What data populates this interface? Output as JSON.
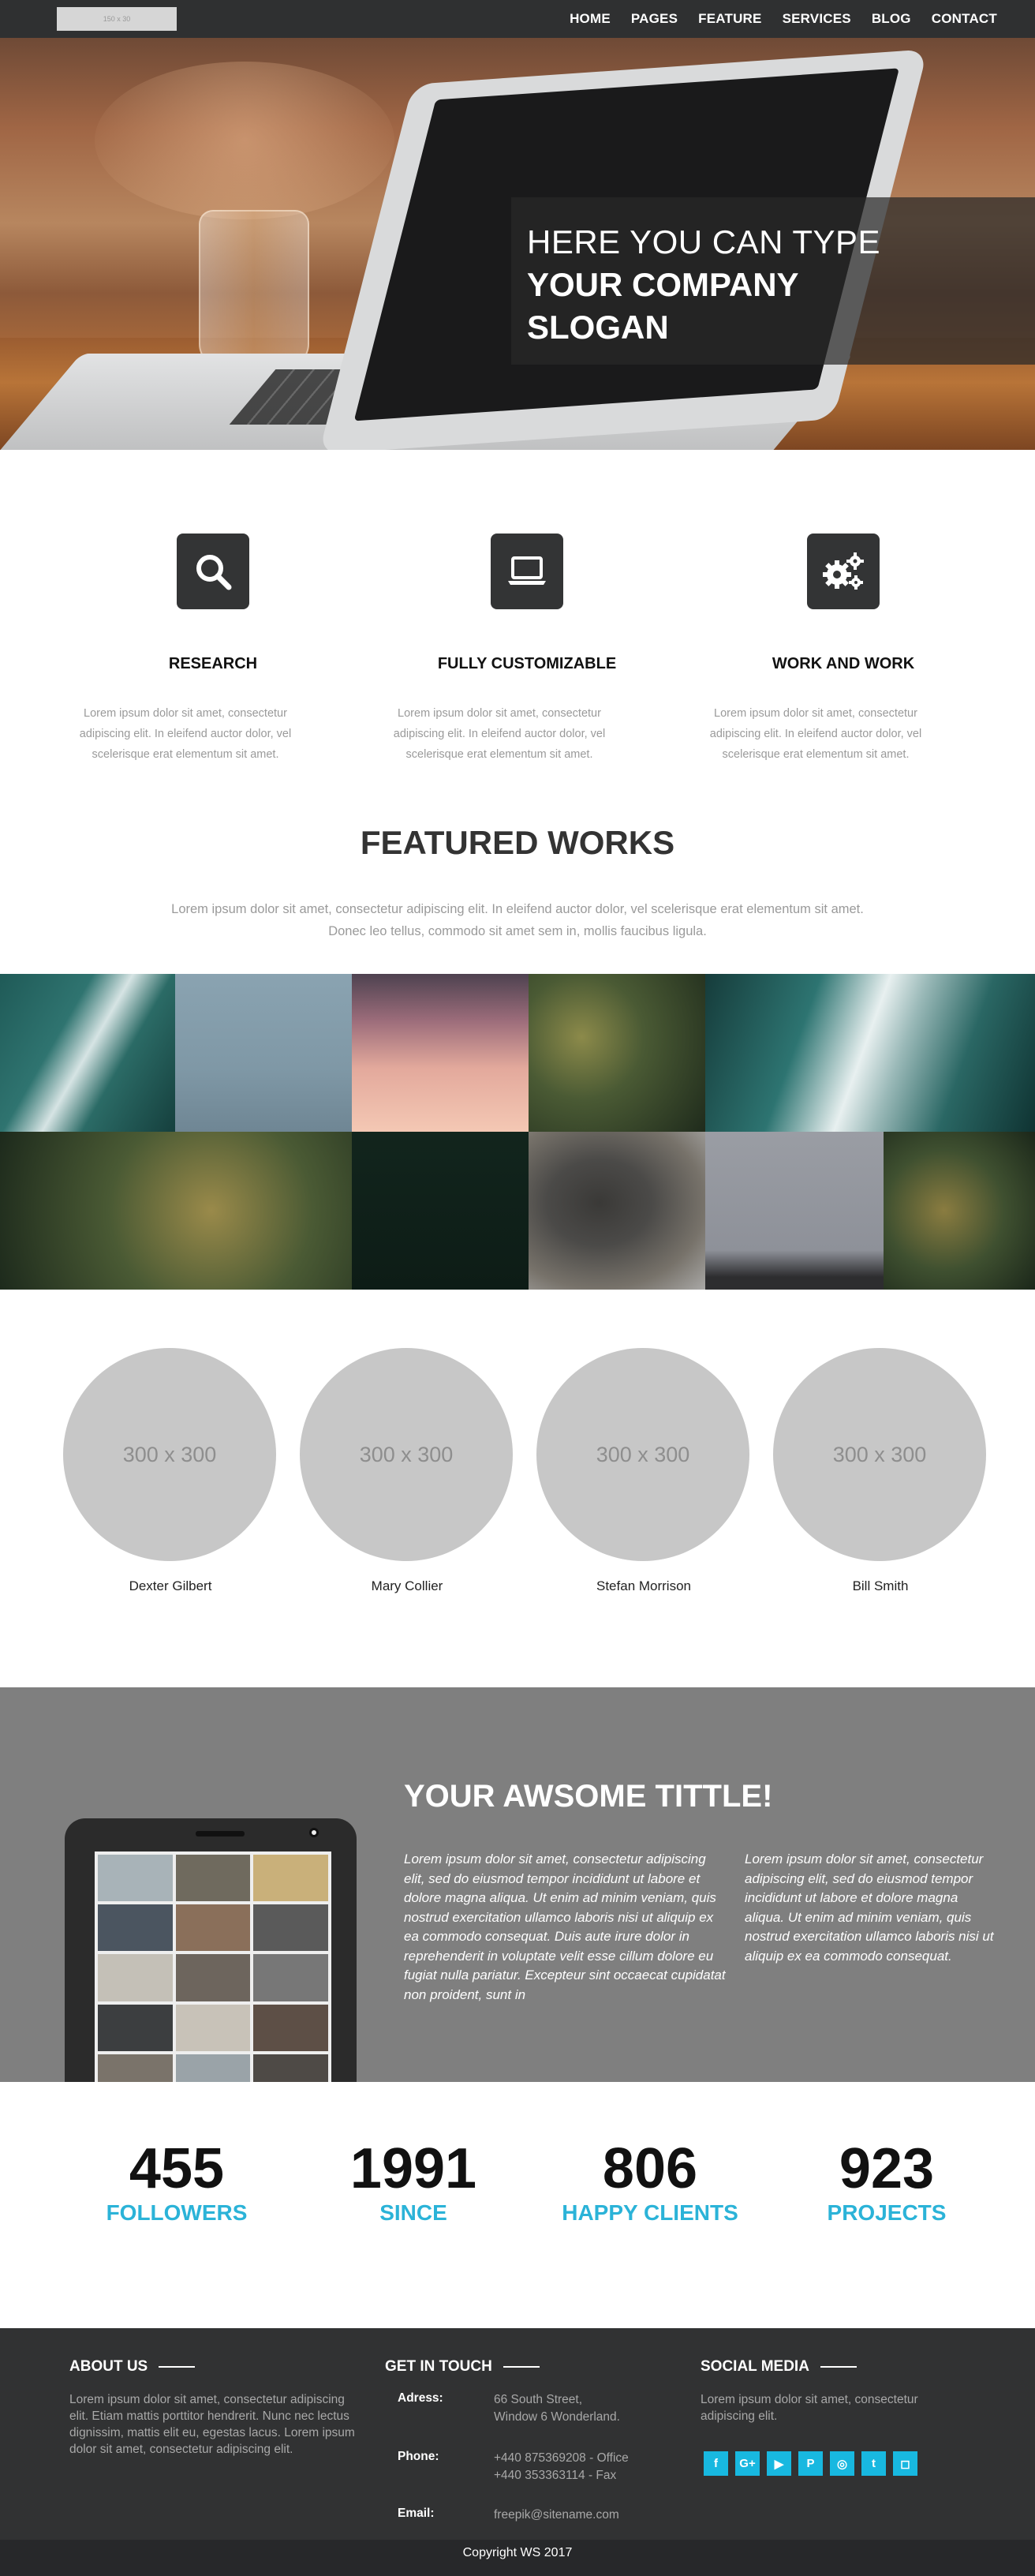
{
  "nav": {
    "logo_text": "150 x 30",
    "items": [
      "HOME",
      "PAGES",
      "FEATURE",
      "SERVICES",
      "BLOG",
      "CONTACT"
    ]
  },
  "hero": {
    "slogan_line1": "HERE YOU CAN TYPE",
    "slogan_line2": "YOUR COMPANY SLOGAN"
  },
  "features": [
    {
      "icon": "search-icon",
      "title": "RESEARCH",
      "text": "Lorem ipsum dolor sit amet, consectetur adipiscing elit. In eleifend auctor dolor, vel scelerisque erat elementum sit amet."
    },
    {
      "icon": "laptop-icon",
      "title": "FULLY CUSTOMIZABLE",
      "text": "Lorem ipsum dolor sit amet, consectetur adipiscing elit. In eleifend auctor dolor, vel scelerisque erat elementum sit amet."
    },
    {
      "icon": "gears-icon",
      "title": "WORK AND WORK",
      "text": "Lorem ipsum dolor sit amet, consectetur adipiscing elit. In eleifend auctor dolor, vel scelerisque erat elementum sit amet."
    }
  ],
  "featured": {
    "title": "FEATURED WORKS",
    "text": "Lorem ipsum dolor sit amet, consectetur adipiscing elit. In eleifend auctor dolor, vel scelerisque erat elementum sit amet. Donec leo tellus, commodo sit amet sem in, mollis faucibus ligula."
  },
  "gallery": {
    "colors": {
      "ocean": "#1f5a57",
      "sky": "#7f98a6",
      "sunset": "#c48b86",
      "forest": "#4a5a34",
      "dark": "#12251d",
      "cup": "#4b4a48",
      "grey": "#8e9199"
    }
  },
  "team": {
    "placeholder": "300 x 300",
    "members": [
      "Dexter Gilbert",
      "Mary Collier",
      "Stefan Morrison",
      "Bill Smith"
    ]
  },
  "awesome": {
    "title": "YOUR AWSOME TITTLE!",
    "col1": "Lorem ipsum dolor sit amet, consectetur adipiscing elit, sed do eiusmod tempor incididunt ut labore et dolore magna aliqua. Ut enim ad minim veniam, quis nostrud exercitation ullamco laboris nisi ut aliquip ex ea commodo consequat. Duis aute irure dolor in reprehenderit in voluptate velit esse cillum dolore eu fugiat nulla pariatur. Excepteur sint occaecat cupidatat non proident, sunt in",
    "col2": "Lorem ipsum dolor sit amet, consectetur adipiscing elit, sed do eiusmod tempor incididunt ut labore et dolore magna aliqua. Ut enim ad minim veniam, quis nostrud exercitation ullamco laboris nisi ut aliquip ex ea commodo consequat."
  },
  "stats": [
    {
      "number": "455",
      "label": "FOLLOWERS"
    },
    {
      "number": "1991",
      "label": "SINCE"
    },
    {
      "number": "806",
      "label": "HAPPY CLIENTS"
    },
    {
      "number": "923",
      "label": "PROJECTS"
    }
  ],
  "footer": {
    "about_title": "ABOUT US",
    "about_text": "Lorem ipsum dolor sit amet, consectetur adipiscing elit. Etiam mattis porttitor hendrerit. Nunc nec lectus dignissim, mattis elit eu, egestas lacus. Lorem ipsum dolor sit amet, consectetur adipiscing elit.",
    "contact_title": "GET IN TOUCH",
    "address_label": "Adress:",
    "address_line1": "66 South Street,",
    "address_line2": "Window 6 Wonderland.",
    "phone_label": "Phone:",
    "phone_line1": "+440 875369208 - Office",
    "phone_line2": "+440 353363114 - Fax",
    "email_label": "Email:",
    "email": "freepik@sitename.com",
    "social_title": "SOCIAL MEDIA",
    "social_text": "Lorem ipsum dolor sit amet, consectetur adipiscing elit.",
    "social_icons": [
      {
        "name": "facebook-icon",
        "glyph": "f"
      },
      {
        "name": "google-plus-icon",
        "glyph": "G+"
      },
      {
        "name": "youtube-icon",
        "glyph": "▶"
      },
      {
        "name": "pinterest-icon",
        "glyph": "P"
      },
      {
        "name": "dribbble-icon",
        "glyph": "◎"
      },
      {
        "name": "twitter-icon",
        "glyph": "t"
      },
      {
        "name": "instagram-icon",
        "glyph": "◻"
      }
    ],
    "copyright": "Copyright WS 2017"
  }
}
